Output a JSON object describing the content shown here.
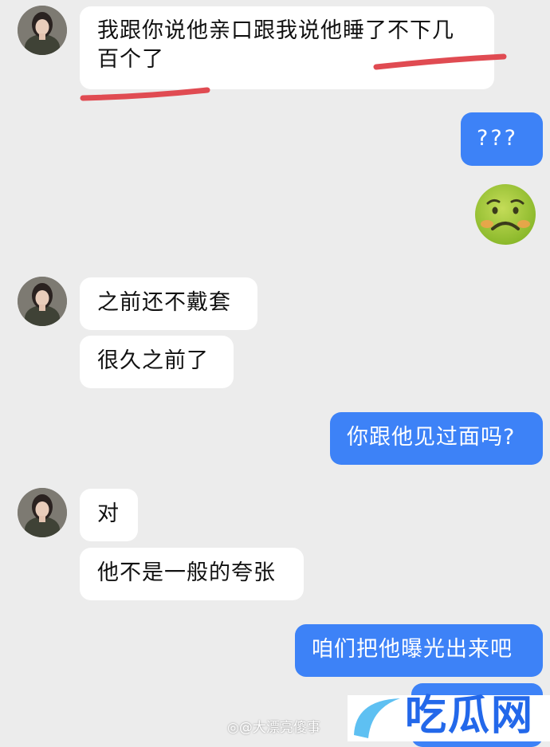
{
  "chat": {
    "messages": [
      {
        "side": "in",
        "lines": [
          "我跟你说他亲口跟我说他睡了不下几",
          "百个了"
        ]
      },
      {
        "side": "out",
        "text": "???"
      },
      {
        "side": "out",
        "emoji": "nauseated-face-icon"
      },
      {
        "side": "in",
        "text": "之前还不戴套"
      },
      {
        "side": "in",
        "text": "很久之前了"
      },
      {
        "side": "out",
        "text": "你跟他见过面吗?"
      },
      {
        "side": "in",
        "text": "对"
      },
      {
        "side": "in",
        "text": "他不是一般的夸张"
      },
      {
        "side": "out",
        "text": "咱们把他曝光出来吧"
      }
    ]
  },
  "watermark": {
    "text": "@大漂亮傻事"
  },
  "logo": {
    "text": "吃瓜网"
  },
  "colors": {
    "background": "#ececec",
    "incoming": "#ffffff",
    "outgoing": "#3d82f7",
    "underline": "#e04b52",
    "logo": "#2368ea"
  }
}
